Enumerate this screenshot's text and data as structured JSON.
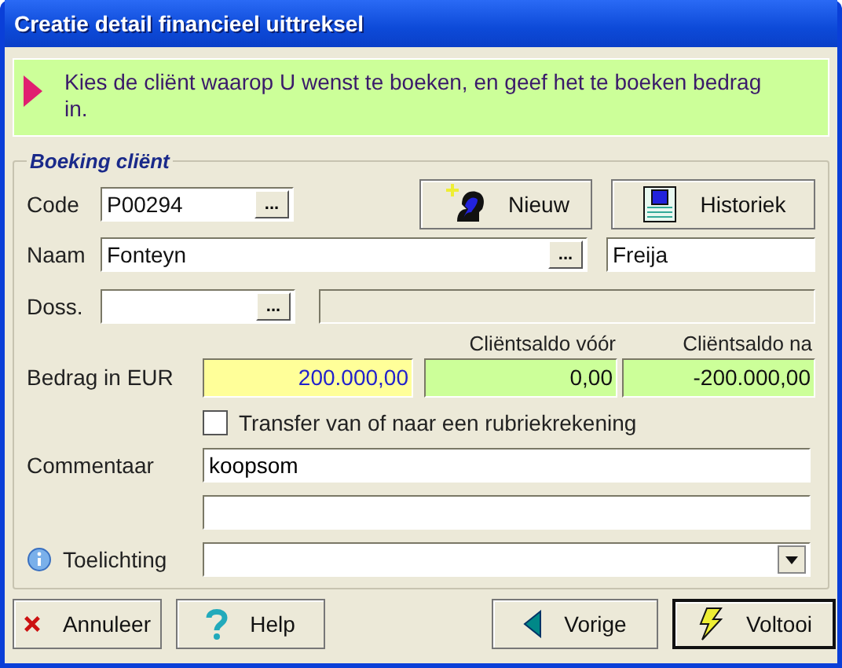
{
  "window": {
    "title": "Creatie detail financieel uittreksel"
  },
  "hint": {
    "text": "Kies de cliënt waarop U wenst te boeken, en geef het te boeken bedrag in."
  },
  "group": {
    "title": "Boeking cliënt"
  },
  "code": {
    "label": "Code",
    "value": "P00294",
    "browse": "..."
  },
  "actions": [
    {
      "label": "Nieuw",
      "kind": "new"
    },
    {
      "label": "Historiek",
      "kind": "history"
    }
  ],
  "name": {
    "label": "Naam",
    "surname": "Fonteyn",
    "browse": "...",
    "first_name": "Freija"
  },
  "dossier": {
    "label": "Doss.",
    "browse": "..."
  },
  "amount": {
    "label": "Bedrag in EUR",
    "value": "200.000,00"
  },
  "balances": [
    {
      "label": "Cliëntsaldo vóór",
      "value": "0,00"
    },
    {
      "label": "Cliëntsaldo na",
      "value": "-200.000,00"
    }
  ],
  "transfer": {
    "label": "Transfer van of naar een rubriekrekening",
    "checked": false
  },
  "comment": {
    "label": "Commentaar",
    "value": "koopsom"
  },
  "explanation": {
    "label": "Toelichting"
  },
  "buttons": [
    {
      "label": "Annuleer",
      "kind": "cancel",
      "default": false
    },
    {
      "label": "Help",
      "kind": "help",
      "default": false
    },
    {
      "label": "Vorige",
      "kind": "back",
      "default": false
    },
    {
      "label": "Voltooi",
      "kind": "finish",
      "default": true
    }
  ]
}
